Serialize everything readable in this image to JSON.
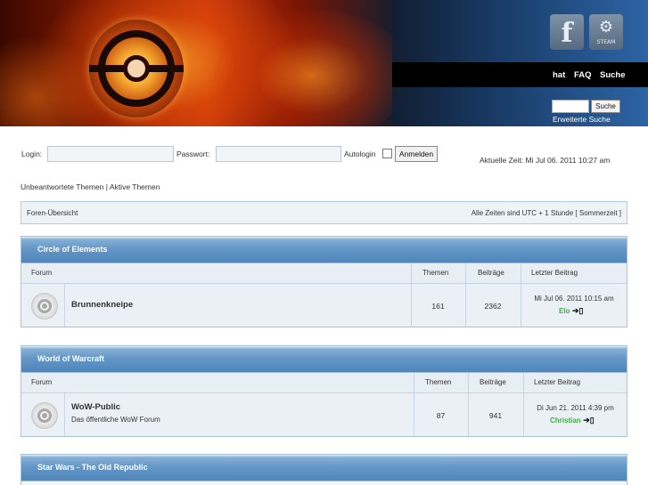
{
  "header": {
    "nav": [
      "hat",
      "FAQ",
      "Suche"
    ],
    "search_button": "Suche",
    "advanced_search": "Erweiterte Suche",
    "social": {
      "facebook_glyph": "f",
      "steam_label": "STEAM"
    }
  },
  "login": {
    "login_label": "Login:",
    "password_label": "Passwort:",
    "autologin_label": "Autologin",
    "submit": "Anmelden",
    "current_time": "Aktuelle Zeit: Mi Jul 06. 2011 10:27 am"
  },
  "quick_links": {
    "unanswered": "Unbeantwortete Themen",
    "separator": "|",
    "active": "Aktive Themen"
  },
  "breadcrumb": {
    "label": "Foren-Übersicht",
    "timezone": "Alle Zeiten sind UTC + 1 Stunde [ Sommerzeit ]"
  },
  "columns": {
    "forum": "Forum",
    "topics": "Themen",
    "posts": "Beiträge",
    "last_post": "Letzter Beitrag"
  },
  "categories": [
    {
      "title": "Circle of Elements",
      "forums": [
        {
          "name": "Brunnenkneipe",
          "description": "",
          "topics": "161",
          "posts": "2362",
          "last_date": "Mi Jul 06. 2011 10:15 am",
          "last_user": "Elo"
        }
      ]
    },
    {
      "title": "World of Warcraft",
      "forums": [
        {
          "name": "WoW-Public",
          "description": "Das öffentliche WoW Forum",
          "topics": "87",
          "posts": "941",
          "last_date": "Di Jun 21. 2011 4:39 pm",
          "last_user": "Christian"
        }
      ]
    },
    {
      "title": "Star Wars - The Old Republic",
      "forums": []
    }
  ],
  "icons": {
    "goto_post": "go-to-last-post-icon",
    "forum": "forum-read-icon"
  },
  "colors": {
    "category_header": "#5a8fc2",
    "username": "#3bb33b",
    "accent_blue": "#2c5e94"
  }
}
